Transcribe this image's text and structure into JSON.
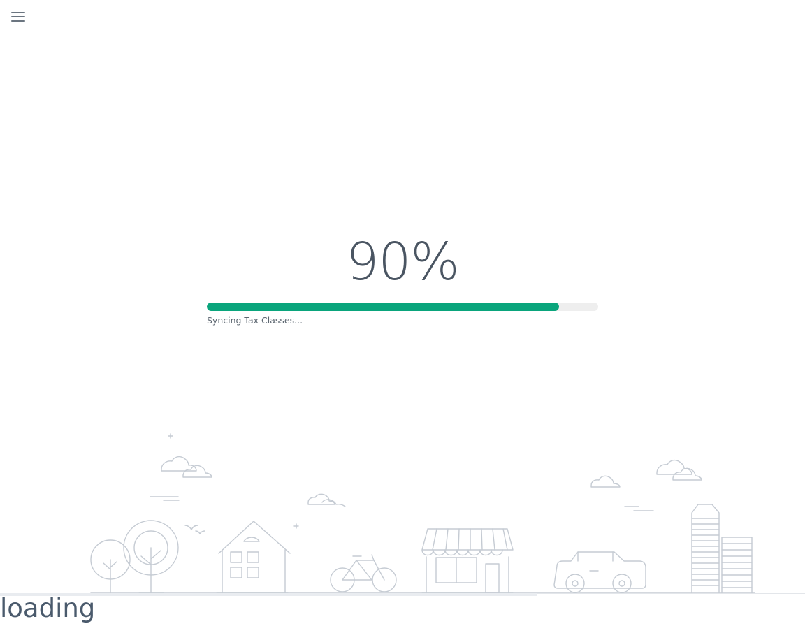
{
  "header": {
    "menu_icon": "hamburger-menu-icon"
  },
  "progress": {
    "percent_label": "90%",
    "value": 0.9,
    "status_text": "Syncing Tax Classes...",
    "fill_color": "#0aa57c",
    "track_color": "#eeeeee"
  },
  "illustration": {
    "icons": [
      "cloud-icon",
      "tree-icon",
      "house-icon",
      "bird-icon",
      "bicycle-icon",
      "storefront-icon",
      "car-icon",
      "building-icon"
    ]
  },
  "footer": {
    "loading_text": "loading"
  }
}
